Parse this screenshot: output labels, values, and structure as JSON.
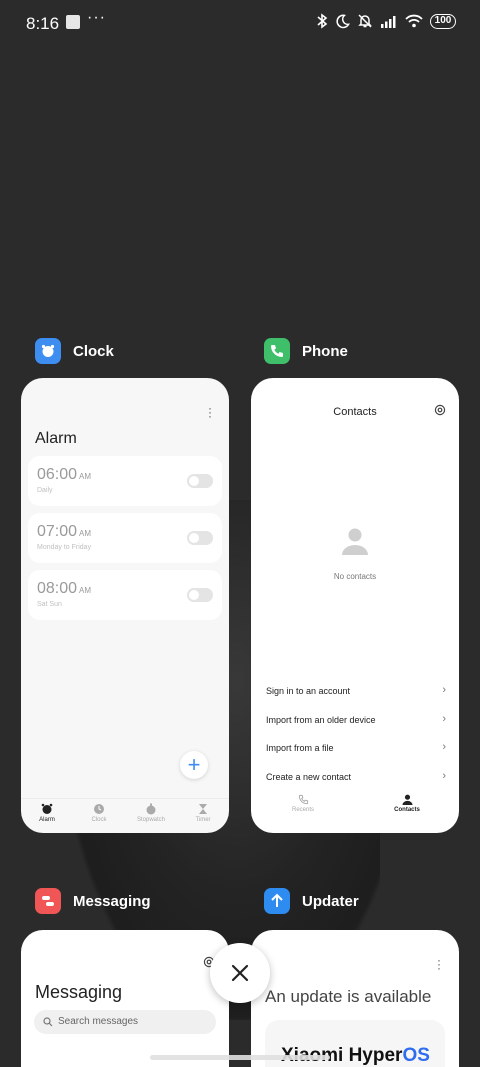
{
  "status_bar": {
    "time": "8:16",
    "dots": "···",
    "battery": "100"
  },
  "apps": {
    "clock": {
      "name": "Clock",
      "icon_color": "#3d8ef0",
      "title": "Alarm",
      "alarms": [
        {
          "time": "06:00",
          "ampm": "AM",
          "repeat": "Daily"
        },
        {
          "time": "07:00",
          "ampm": "AM",
          "repeat": "Monday to Friday"
        },
        {
          "time": "08:00",
          "ampm": "AM",
          "repeat": "Sat Sun"
        }
      ],
      "add_label": "+",
      "tabs": [
        {
          "label": "Alarm",
          "active": true
        },
        {
          "label": "Clock",
          "active": false
        },
        {
          "label": "Stopwatch",
          "active": false
        },
        {
          "label": "Timer",
          "active": false
        }
      ]
    },
    "phone": {
      "name": "Phone",
      "icon_color": "#3fbf6a",
      "title": "Contacts",
      "empty_text": "No contacts",
      "menu": [
        "Sign in to an account",
        "Import from an older device",
        "Import from a file",
        "Create a new contact"
      ],
      "tabs": [
        {
          "label": "Recents",
          "active": false
        },
        {
          "label": "Contacts",
          "active": true
        }
      ]
    },
    "messaging": {
      "name": "Messaging",
      "icon_color": "#f05656",
      "title": "Messaging",
      "search_placeholder": "Search messages"
    },
    "updater": {
      "name": "Updater",
      "icon_color": "#2e8cf0",
      "title": "An update is available",
      "brand_prefix": "Xiaomi Hyper",
      "brand_suffix": "OS"
    }
  },
  "close_label": "×"
}
